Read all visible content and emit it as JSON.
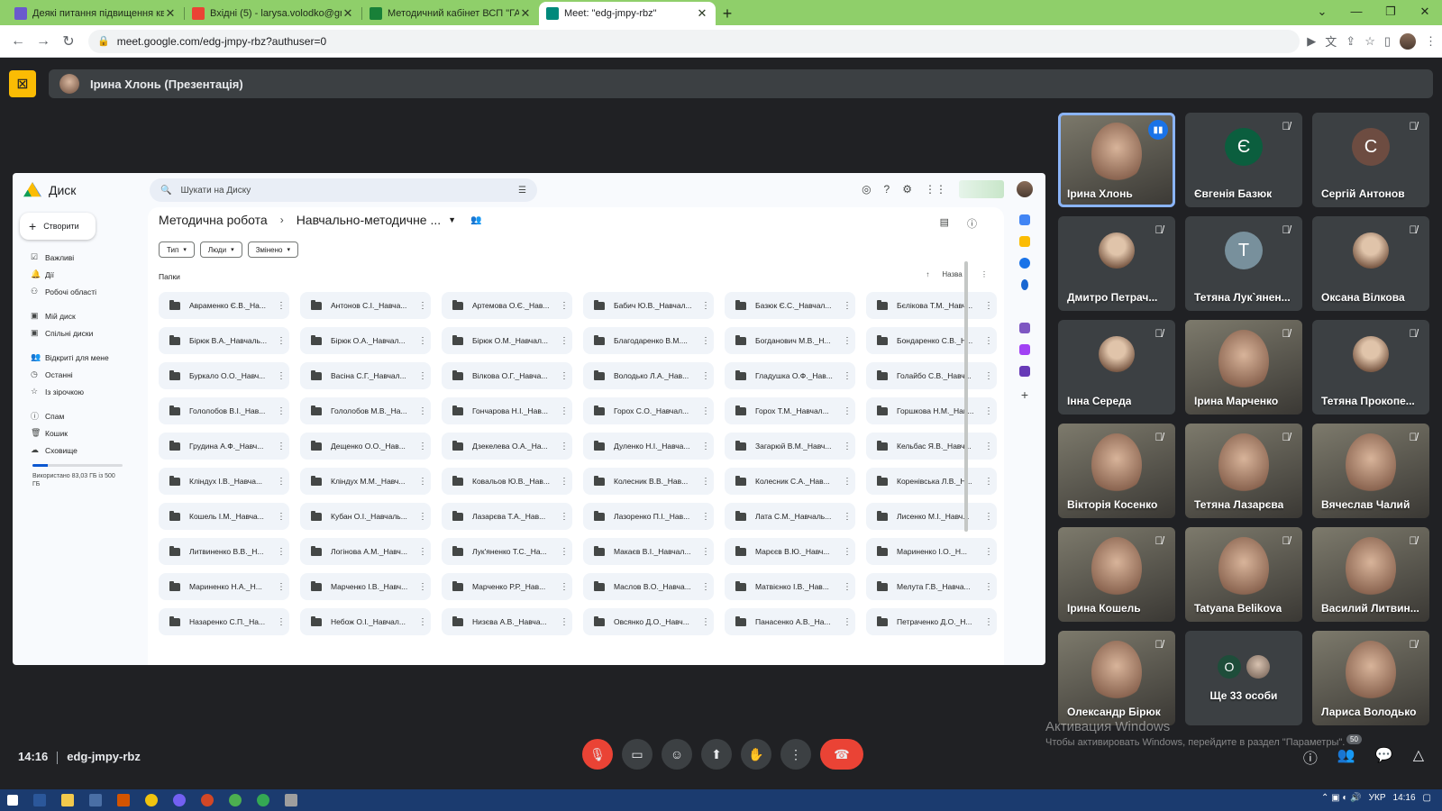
{
  "browser": {
    "tabs": [
      {
        "title": "Деякі питання підвищення ква",
        "color": "#6a5acd",
        "active": false
      },
      {
        "title": "Вхідні (5) - larysa.volodko@gm",
        "color": "#ea4335",
        "active": false
      },
      {
        "title": "Методичний кабінет ВСП \"ГАФ",
        "color": "#188038",
        "active": false
      },
      {
        "title": "Meet: \"edg-jmpy-rbz\"",
        "color": "#00897b",
        "active": true
      }
    ],
    "new_tab": "+",
    "url": "meet.google.com/edg-jmpy-rbz?authuser=0"
  },
  "presentation": {
    "presenter": "Ірина Хлонь (Презентація)"
  },
  "drive": {
    "app_name": "Диск",
    "search_placeholder": "Шукати на Диску",
    "create_label": "Створити",
    "nav": [
      {
        "icon": "☑",
        "label": "Важливі"
      },
      {
        "icon": "🔔",
        "label": "Дії"
      },
      {
        "icon": "⚇",
        "label": "Робочі області"
      },
      {
        "icon": "▣",
        "label": "Мій диск"
      },
      {
        "icon": "▣",
        "label": "Спільні диски"
      },
      {
        "icon": "👥",
        "label": "Відкриті для мене"
      },
      {
        "icon": "◷",
        "label": "Останні"
      },
      {
        "icon": "☆",
        "label": "Із зірочкою"
      },
      {
        "icon": "ⓘ",
        "label": "Спам"
      },
      {
        "icon": "🗑",
        "label": "Кошик"
      },
      {
        "icon": "☁",
        "label": "Сховище"
      }
    ],
    "storage_text": "Використано 83,03 ГБ із 500 ГБ",
    "storage_fraction": 0.17,
    "breadcrumb": [
      "Методична робота",
      "Навчально-методичне ..."
    ],
    "filters": [
      "Тип",
      "Люди",
      "Змінено"
    ],
    "section_label": "Папки",
    "sort_label": "Назва",
    "folders": [
      "Авраменко Є.В._На...",
      "Антонов С.І._Навча...",
      "Артемова О.Є._Нав...",
      "Бабич Ю.В._Навчал...",
      "Базюк Є.С._Навчал...",
      "Бєлікова Т.М._Навч...",
      "Бірюк В.А._Навчаль...",
      "Бірюк О.А._Навчал...",
      "Бірюк О.М._Навчал...",
      "Благодаренко В.М....",
      "Богданович М.В._Н...",
      "Бондаренко С.В._Н...",
      "Буркало О.О._Навч...",
      "Васіна С.Г._Навчал...",
      "Вілкова О.Г._Навча...",
      "Володько Л.А._Нав...",
      "Гладушка О.Ф._Нав...",
      "Голайбо С.В._Навч...",
      "Гололобов В.І._Нав...",
      "Гололобов М.В._На...",
      "Гончарова Н.І._Нав...",
      "Горох С.О._Навчал...",
      "Горох Т.М._Навчал...",
      "Горшкова Н.М._Нав...",
      "Грудина А.Ф._Навч...",
      "Дещенко О.О._Нав...",
      "Дзекелева О.А._На...",
      "Дуленко Н.І._Навча...",
      "Загарюй В.М._Навч...",
      "Кельбас Я.В._Навч...",
      "Кліндух І.В._Навча...",
      "Кліндух М.М._Навч...",
      "Ковальов Ю.В._Нав...",
      "Колесник В.В._Нав...",
      "Колесник С.А._Нав...",
      "Коренівська Л.В._Н...",
      "Кошель І.М._Навча...",
      "Кубан О.І._Навчаль...",
      "Лазарєва Т.А._Нав...",
      "Лазоренко П.І._Нав...",
      "Лата С.М._Навчаль...",
      "Лисенко М.І._Навч...",
      "Литвиненко В.В._Н...",
      "Логінова А.М._Навч...",
      "Лук'яненко Т.С._На...",
      "Макаєв В.І._Навчал...",
      "Марєєв В.Ю._Навч...",
      "Мариненко І.О._Н...",
      "Мариненко Н.А._Н...",
      "Марченко І.В._Навч...",
      "Марченко Р.Р._Нав...",
      "Маслов В.О._Навча...",
      "Матвієнко І.В._Нав...",
      "Мелута Г.В._Навча...",
      "Назаренко С.П._На...",
      "Небож О.І._Навчал...",
      "Низєва А.В._Навча...",
      "Овсянко Д.О._Навч...",
      "Панасенко А.В._На...",
      "Петраченко Д.О._Н..."
    ]
  },
  "participants": [
    {
      "name": "Ірина Хлонь",
      "type": "video",
      "speaking": true
    },
    {
      "name": "Євгенія Базюк",
      "type": "letter",
      "letter": "Є",
      "color": "#0b5e3e",
      "muted": true
    },
    {
      "name": "Сергій Антонов",
      "type": "letter",
      "letter": "С",
      "color": "#6d4c41",
      "muted": true
    },
    {
      "name": "Дмитро Петрач...",
      "type": "photo",
      "muted": true
    },
    {
      "name": "Тетяна Лук`янен...",
      "type": "letter",
      "letter": "Т",
      "color": "#78909c",
      "muted": true
    },
    {
      "name": "Оксана Вілкова",
      "type": "photo",
      "muted": true
    },
    {
      "name": "Інна Середа",
      "type": "photo",
      "muted": true
    },
    {
      "name": "Ірина Марченко",
      "type": "video",
      "muted": true
    },
    {
      "name": "Тетяна Прокопе...",
      "type": "photo",
      "muted": true
    },
    {
      "name": "Вікторія Косенко",
      "type": "video",
      "muted": true
    },
    {
      "name": "Тетяна Лазарєва",
      "type": "video",
      "muted": true
    },
    {
      "name": "Вячеслав Чалий",
      "type": "video",
      "muted": true
    },
    {
      "name": "Ірина Кошель",
      "type": "video",
      "muted": true
    },
    {
      "name": "Tatyana Belikova",
      "type": "video",
      "muted": true
    },
    {
      "name": "Василий Литвин...",
      "type": "video",
      "muted": true
    },
    {
      "name": "Олександр Бірюк",
      "type": "video",
      "muted": true
    },
    {
      "name": "Ще 33 особи",
      "type": "more",
      "letter": "О"
    },
    {
      "name": "Лариса Володько",
      "type": "video",
      "muted": true
    }
  ],
  "watermark": {
    "line1": "Активация Windows",
    "line2": "Чтобы активировать Windows, перейдите в раздел \"Параметры\"."
  },
  "meeting": {
    "time": "14:16",
    "code": "edg-jmpy-rbz",
    "people_badge": "50"
  },
  "taskbar": {
    "lang": "УКР",
    "clock": "14:16"
  }
}
